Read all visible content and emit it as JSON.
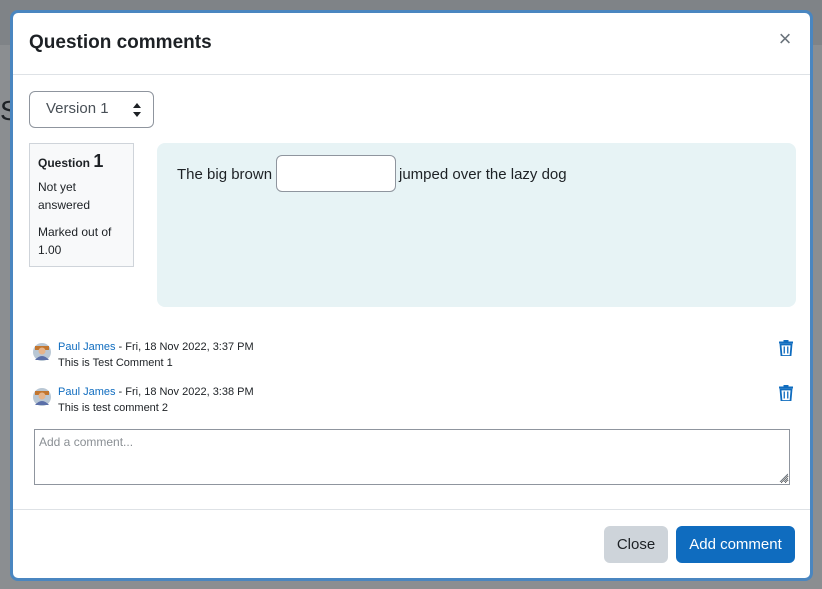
{
  "backdrop": {
    "letter": "S"
  },
  "modal": {
    "title": "Question comments",
    "close_symbol": "×"
  },
  "version_select": {
    "selected": "Version 1"
  },
  "question_info": {
    "label": "Question",
    "number": "1",
    "state": "Not yet answered",
    "grade": "Marked out of 1.00"
  },
  "question_text": {
    "before": "The big brown",
    "after": "jumped over the lazy dog",
    "gap_value": ""
  },
  "comments": [
    {
      "author": "Paul James",
      "date": " - Fri, 18 Nov 2022, 3:37 PM",
      "text": "This is Test Comment 1"
    },
    {
      "author": "Paul James",
      "date": " - Fri, 18 Nov 2022, 3:38 PM",
      "text": "This is test comment 2"
    }
  ],
  "comment_input": {
    "placeholder": "Add a comment..."
  },
  "footer": {
    "close_label": "Close",
    "add_label": "Add comment"
  },
  "colors": {
    "primary": "#0f6cbf",
    "question_bg": "#e7f3f5",
    "modal_border": "#4a86c0"
  },
  "icons": {
    "delete": "trash-icon",
    "avatar": "user-avatar-icon",
    "close": "close-icon"
  }
}
